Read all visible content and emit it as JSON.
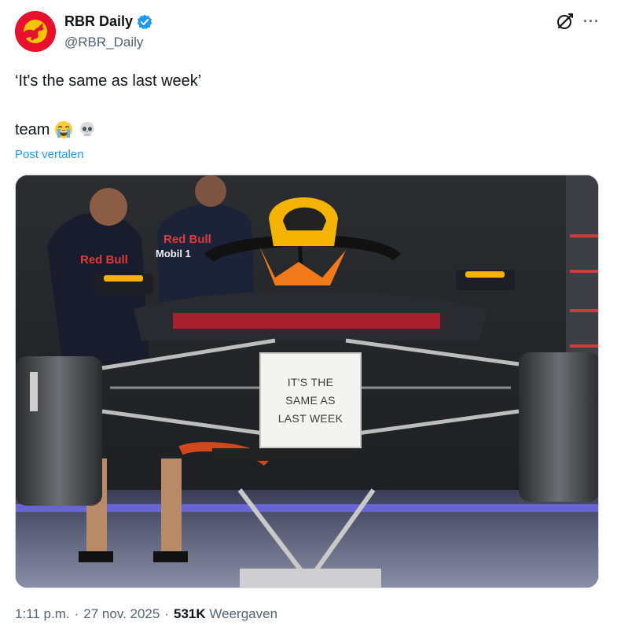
{
  "author": {
    "display_name": "RBR Daily",
    "handle": "@RBR_Daily",
    "verified": true,
    "verified_color": "#1d9bf0",
    "avatar_icon": "red-bull-logo-avatar"
  },
  "header_icons": {
    "grok": "grok-icon",
    "more": "more-options-icon",
    "more_glyph": "···"
  },
  "tweet": {
    "line1": "‘It's the same as last week’",
    "line2_text": "team",
    "emojis": [
      "loudly-crying-face-emoji",
      "skull-emoji"
    ],
    "translate_label": "Post vertalen"
  },
  "media": {
    "alt": "Red Bull F1 car front with a sign",
    "sign_lines": [
      "IT'S THE",
      "SAME AS",
      "LAST WEEK"
    ],
    "car_livery_text": [
      "Red Bull",
      "Mobil 1",
      "Red Bull"
    ]
  },
  "footer": {
    "time": "1:11 p.m.",
    "separator": "·",
    "date": "27 nov. 2025",
    "separator2": "·",
    "views_count": "531K",
    "views_label": "Weergaven"
  },
  "colors": {
    "link": "#1d9bf0",
    "muted": "#536471",
    "text": "#0f1419"
  }
}
